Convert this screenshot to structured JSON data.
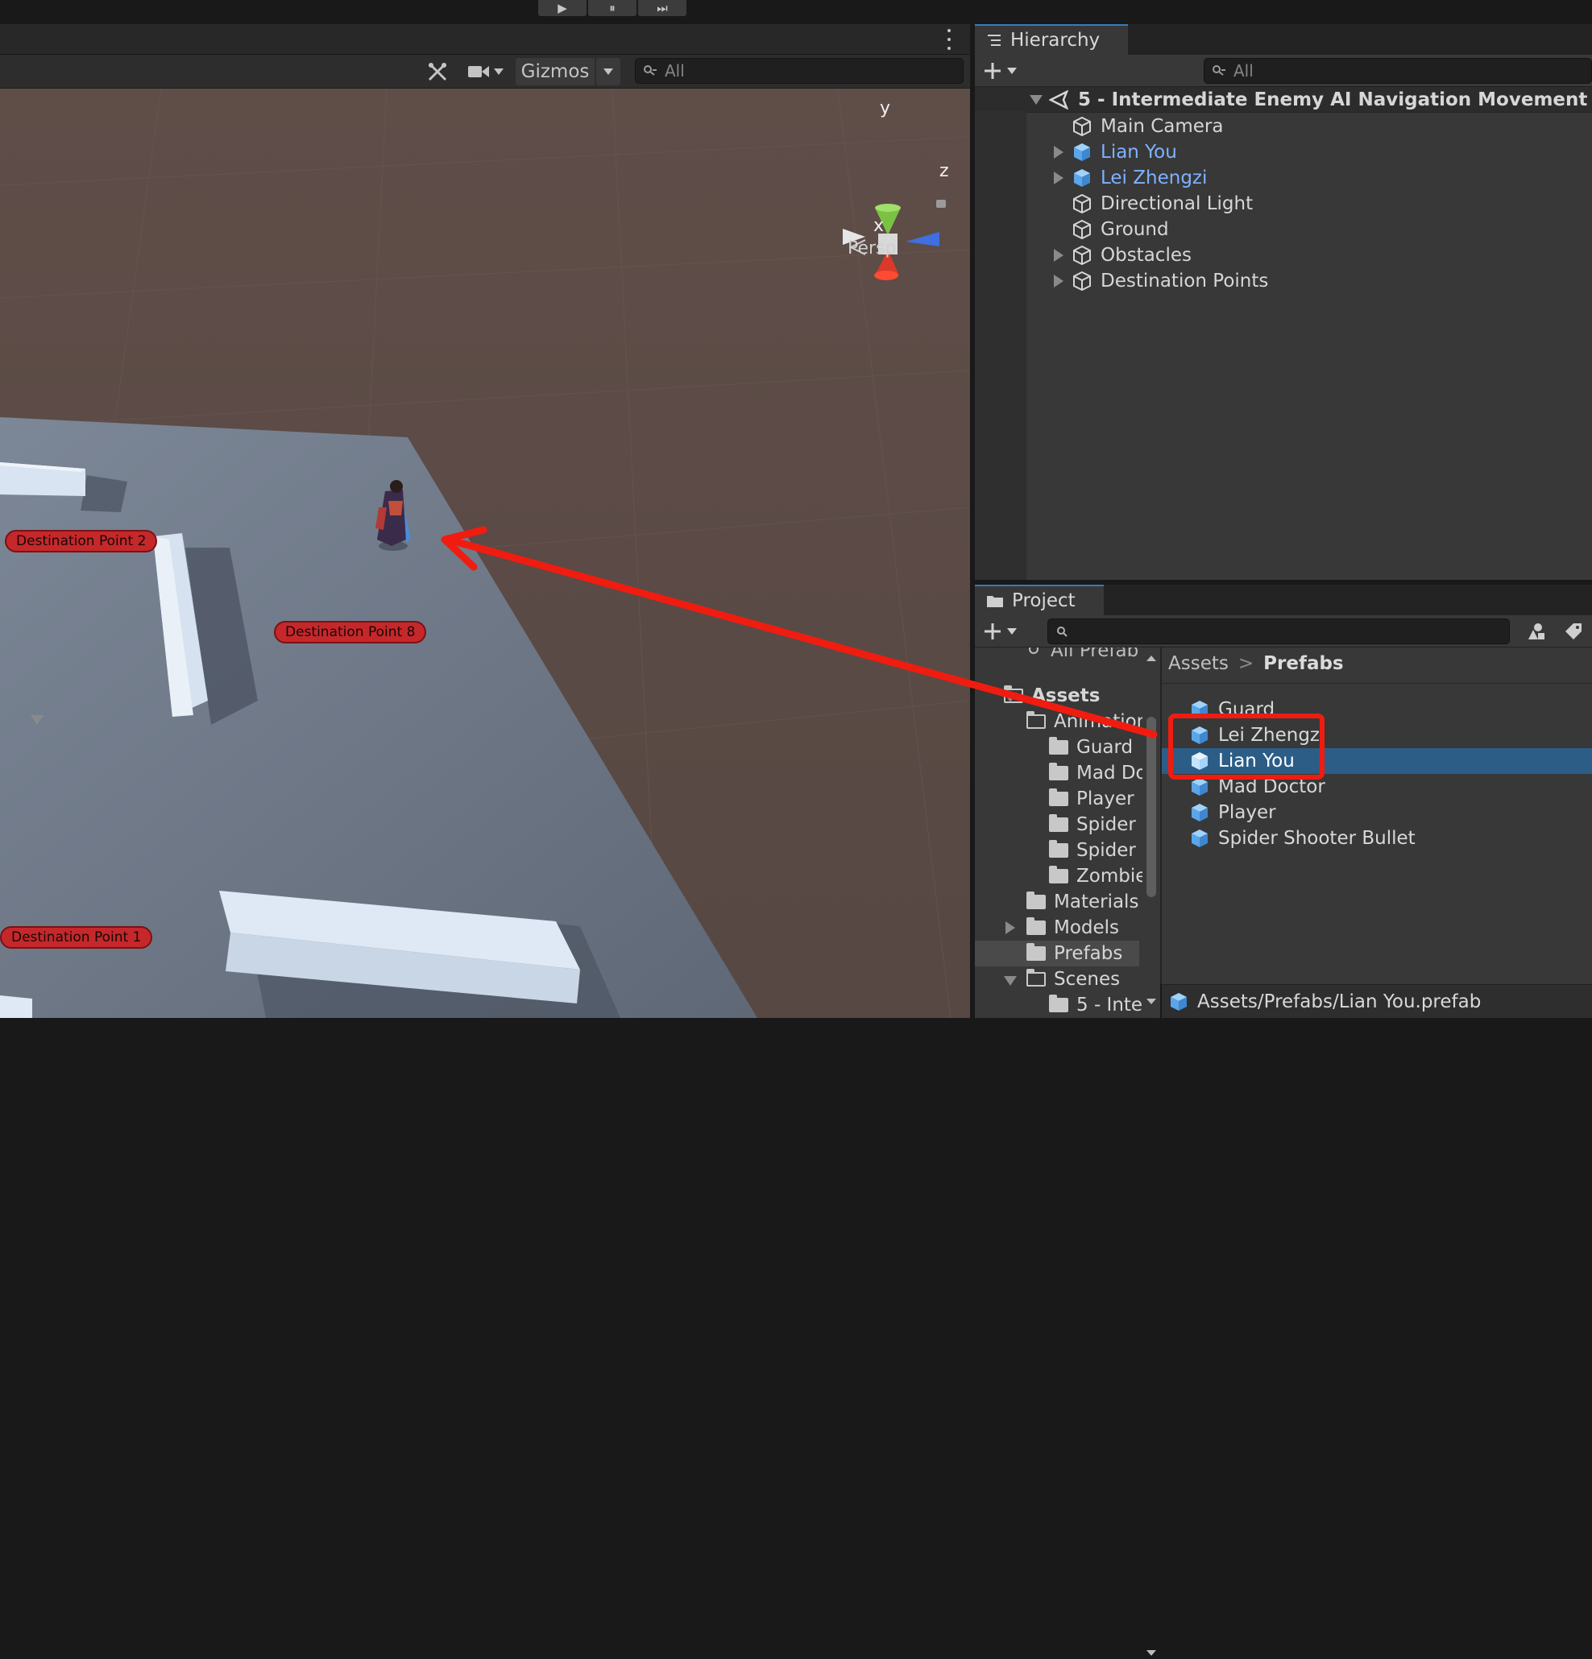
{
  "toolbar": {
    "play_icon": "▶",
    "pause_icon": "⏸",
    "step_icon": "⏭"
  },
  "scene": {
    "gizmos_label": "Gizmos",
    "search_placeholder": "All",
    "axis_y": "y",
    "axis_z": "z",
    "axis_x": "x",
    "projection_label": "Persp",
    "destination_labels": [
      "Destination Point 2",
      "Destination Point 8",
      "Destination Point 1"
    ]
  },
  "hierarchy": {
    "tab_label": "Hierarchy",
    "search_placeholder": "All",
    "scene_name": "5 - Intermediate Enemy AI Navigation Movement",
    "items": [
      {
        "label": "Main Camera",
        "prefab": false,
        "expandable": false
      },
      {
        "label": "Lian You",
        "prefab": true,
        "expandable": true
      },
      {
        "label": "Lei Zhengzi",
        "prefab": true,
        "expandable": true
      },
      {
        "label": "Directional Light",
        "prefab": false,
        "expandable": false
      },
      {
        "label": "Ground",
        "prefab": false,
        "expandable": false
      },
      {
        "label": "Obstacles",
        "prefab": false,
        "expandable": true
      },
      {
        "label": "Destination Points",
        "prefab": false,
        "expandable": true
      }
    ]
  },
  "project": {
    "tab_label": "Project",
    "tree_partial_top": "All Prefab",
    "tree": [
      {
        "label": "Assets",
        "bold": true
      },
      {
        "label": "Animation"
      },
      {
        "label": "Guard"
      },
      {
        "label": "Mad Do"
      },
      {
        "label": "Player"
      },
      {
        "label": "Spider"
      },
      {
        "label": "Spider"
      },
      {
        "label": "Zombie"
      },
      {
        "label": "Materials"
      },
      {
        "label": "Models"
      },
      {
        "label": "Prefabs"
      },
      {
        "label": "Scenes"
      },
      {
        "label": "5 - Inte"
      }
    ],
    "breadcrumb_root": "Assets",
    "breadcrumb_current": "Prefabs",
    "breadcrumb_sep": ">",
    "assets": [
      {
        "label": "Guard"
      },
      {
        "label": "Lei Zhengzi"
      },
      {
        "label": "Lian You",
        "selected": true
      },
      {
        "label": "Mad Doctor"
      },
      {
        "label": "Player"
      },
      {
        "label": "Spider Shooter Bullet"
      }
    ],
    "status_path": "Assets/Prefabs/Lian You.prefab"
  },
  "colors": {
    "annotation_red": "#f01c10",
    "selection_blue": "#2c5d87",
    "prefab_blue": "#7fb2ff"
  }
}
